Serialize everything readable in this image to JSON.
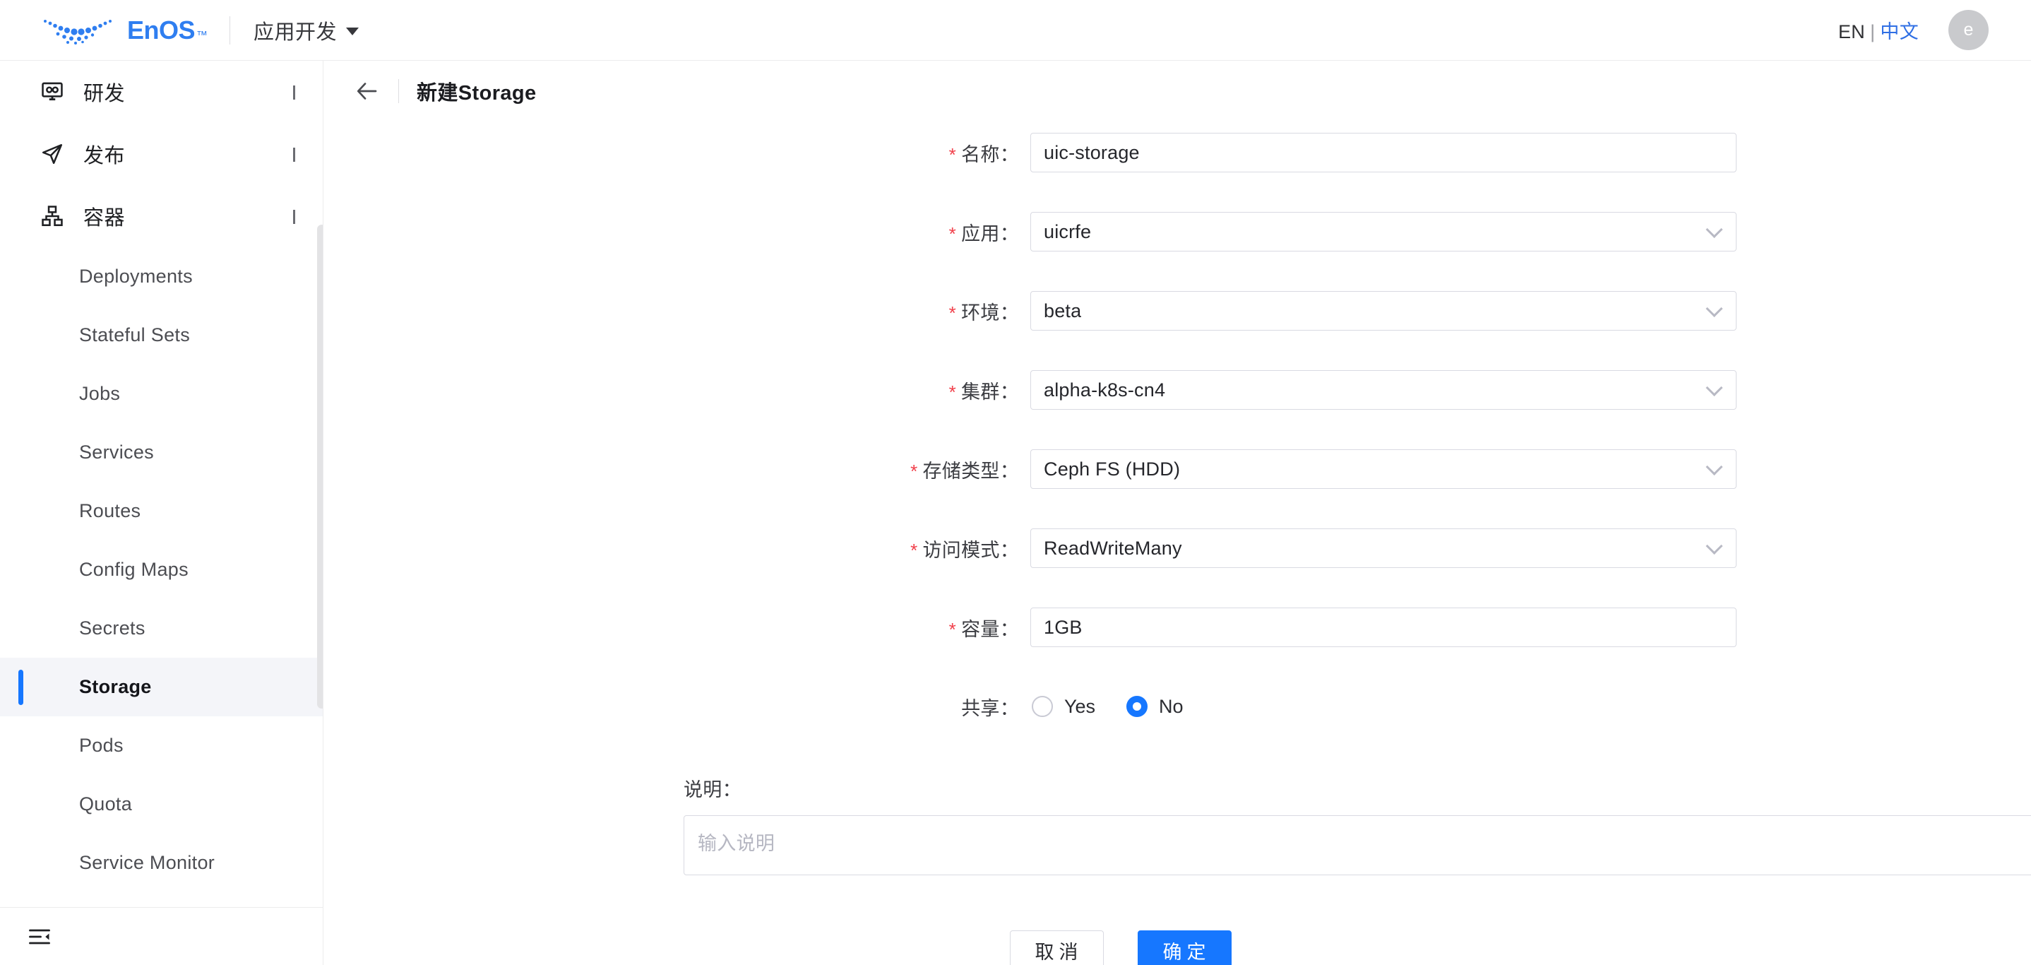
{
  "topbar": {
    "brand_name": "EnOS",
    "brand_tm": "™",
    "app_switcher_label": "应用开发",
    "lang_en": "EN",
    "lang_sep": "|",
    "lang_zh": "中文",
    "avatar_initial": "e",
    "accent_color": "#1677ff",
    "lang_active_color": "#2f6fe4"
  },
  "sidebar": {
    "groups": [
      {
        "label": "研发",
        "icon": "dev-monitor-icon",
        "expanded": false
      },
      {
        "label": "发布",
        "icon": "paper-plane-icon",
        "expanded": false
      },
      {
        "label": "容器",
        "icon": "container-hierarchy-icon",
        "expanded": true
      }
    ],
    "items": [
      {
        "label": "Deployments",
        "active": false
      },
      {
        "label": "Stateful Sets",
        "active": false
      },
      {
        "label": "Jobs",
        "active": false
      },
      {
        "label": "Services",
        "active": false
      },
      {
        "label": "Routes",
        "active": false
      },
      {
        "label": "Config Maps",
        "active": false
      },
      {
        "label": "Secrets",
        "active": false
      },
      {
        "label": "Storage",
        "active": true
      },
      {
        "label": "Pods",
        "active": false
      },
      {
        "label": "Quota",
        "active": false
      },
      {
        "label": "Service Monitor",
        "active": false
      }
    ],
    "collapse_icon": "collapse-sidebar-icon",
    "active_indicator_color": "#1677ff",
    "active_bg_color": "#f4f5f9"
  },
  "page": {
    "back_icon": "back-arrow-icon",
    "title": "新建Storage"
  },
  "form": {
    "fields": [
      {
        "label": "名称",
        "required": true,
        "type": "text",
        "value": "uic-storage"
      },
      {
        "label": "应用",
        "required": true,
        "type": "select",
        "value": "uicrfe"
      },
      {
        "label": "环境",
        "required": true,
        "type": "select",
        "value": "beta"
      },
      {
        "label": "集群",
        "required": true,
        "type": "select",
        "value": "alpha-k8s-cn4"
      },
      {
        "label": "存储类型",
        "required": true,
        "type": "select",
        "value": "Ceph FS (HDD)"
      },
      {
        "label": "访问模式",
        "required": true,
        "type": "select",
        "value": "ReadWriteMany"
      },
      {
        "label": "容量",
        "required": true,
        "type": "text",
        "value": "1GB"
      }
    ],
    "share": {
      "label": "共享",
      "required": false,
      "options": [
        {
          "label": "Yes",
          "selected": false
        },
        {
          "label": "No",
          "selected": true
        }
      ]
    },
    "description": {
      "label": "说明：",
      "placeholder": "输入说明",
      "value": ""
    },
    "label_suffix": "：",
    "required_mark": "*"
  },
  "actions": {
    "cancel_label": "取消",
    "confirm_label": "确定"
  }
}
